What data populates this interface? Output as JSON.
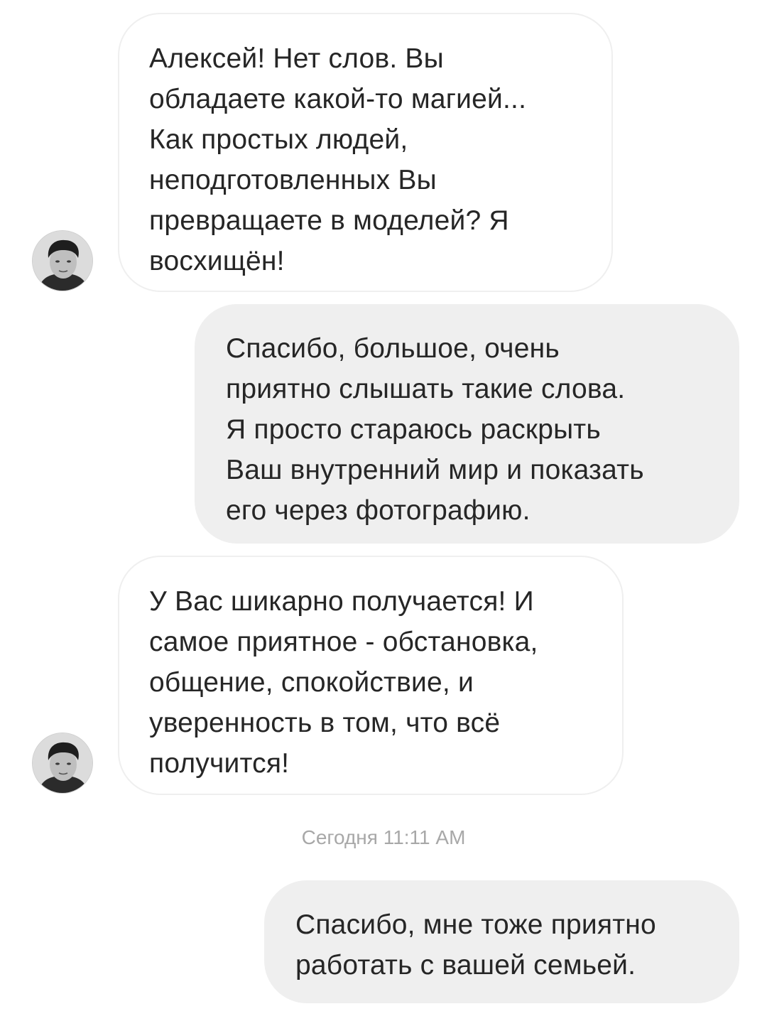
{
  "conversation": {
    "messages": [
      {
        "direction": "incoming",
        "lines": [
          "Алексей! Нет слов. Вы",
          "обладаете какой-то магией...",
          "Как простых людей,",
          "неподготовленных Вы",
          "превращаете в моделей? Я",
          "восхищён!"
        ]
      },
      {
        "direction": "outgoing",
        "lines": [
          "Спасибо, большое, очень",
          "приятно слышать такие слова.",
          "Я просто стараюсь раскрыть",
          "Ваш внутренний мир и показать",
          "его через фотографию."
        ]
      },
      {
        "direction": "incoming",
        "lines": [
          "У Вас шикарно получается! И",
          "самое приятное - обстановка,",
          "общение, спокойствие, и",
          "уверенность в том, что всё",
          "получится!"
        ]
      },
      {
        "direction": "outgoing",
        "lines": [
          "Спасибо, мне тоже приятно",
          "работать с вашей семьей."
        ]
      }
    ],
    "timestamp": "Сегодня 11:11 AM",
    "avatar_icon": "user-photo-avatar"
  },
  "colors": {
    "outgoing_bubble": "#efefef",
    "incoming_border": "#efefef",
    "text": "#262626",
    "timestamp": "#a8a8a8"
  }
}
